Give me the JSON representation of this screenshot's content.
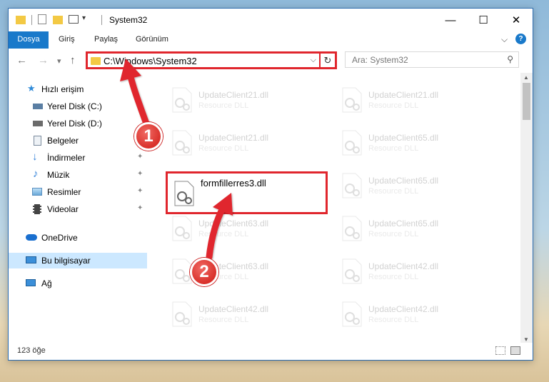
{
  "window": {
    "title": "System32",
    "controls": {
      "minimize": "—",
      "maximize": "☐",
      "close": "✕"
    }
  },
  "ribbon": {
    "tabs": [
      "Dosya",
      "Giriş",
      "Paylaş",
      "Görünüm"
    ],
    "expand_icon": "chevron-down-icon",
    "help_icon": "?"
  },
  "navigation": {
    "back_icon": "←",
    "forward_icon": "→",
    "recent_icon": "▾",
    "up_icon": "↑",
    "address": "C:\\Windows\\System32",
    "address_dropdown": "⌵",
    "refresh_icon": "↻",
    "search_placeholder": "Ara: System32",
    "search_icon": "⚲"
  },
  "sidebar": {
    "items": [
      {
        "label": "Hızlı erişim",
        "icon": "star-icon",
        "color": "#2f8ad8"
      },
      {
        "label": "Yerel Disk (C:)",
        "icon": "drive-icon",
        "color": "#5a7ea3"
      },
      {
        "label": "Yerel Disk (D:)",
        "icon": "drive-icon",
        "color": "#6b6b6b"
      },
      {
        "label": "Belgeler",
        "icon": "documents-icon",
        "color": "#7a8a9c"
      },
      {
        "label": "İndirmeler",
        "icon": "download-icon",
        "color": "#2f7fd8"
      },
      {
        "label": "Müzik",
        "icon": "music-icon",
        "color": "#2f7fd8"
      },
      {
        "label": "Resimler",
        "icon": "pictures-icon",
        "color": "#5a8fbf"
      },
      {
        "label": "Videolar",
        "icon": "videos-icon",
        "color": "#444444"
      },
      {
        "label": "OneDrive",
        "icon": "cloud-icon",
        "color": "#1a6fcf"
      },
      {
        "label": "Bu bilgisayar",
        "icon": "computer-icon",
        "color": "#3b8fd9"
      },
      {
        "label": "Ağ",
        "icon": "network-icon",
        "color": "#3b8fd9"
      }
    ],
    "pin_icon": "📌"
  },
  "files": {
    "highlighted": {
      "name": "formfillerres3.dll",
      "type": ""
    },
    "background": [
      {
        "name": "UpdateClient21.dll",
        "type": "Resource DLL"
      },
      {
        "name": "UpdateClient21.dll",
        "type": "Resource DLL"
      },
      {
        "name": "UpdateClient21.dll",
        "type": "Resource DLL"
      },
      {
        "name": "UpdateClient65.dll",
        "type": "Resource DLL"
      },
      {
        "name": "UpdateClient65.dll",
        "type": "Resource DLL"
      },
      {
        "name": "UpdateClient63.dll",
        "type": "Resource DLL"
      },
      {
        "name": "UpdateClient65.dll",
        "type": "Resource DLL"
      },
      {
        "name": "UpdateClient63.dll",
        "type": "Resource DLL"
      },
      {
        "name": "UpdateClient42.dll",
        "type": "Resource DLL"
      },
      {
        "name": "UpdateClient42.dll",
        "type": "Resource DLL"
      },
      {
        "name": "UpdateClient42.dll",
        "type": "Resource DLL"
      }
    ]
  },
  "status": {
    "count": "123 öğe"
  },
  "callouts": {
    "step1": "1",
    "step2": "2",
    "color": "#e0262d"
  }
}
